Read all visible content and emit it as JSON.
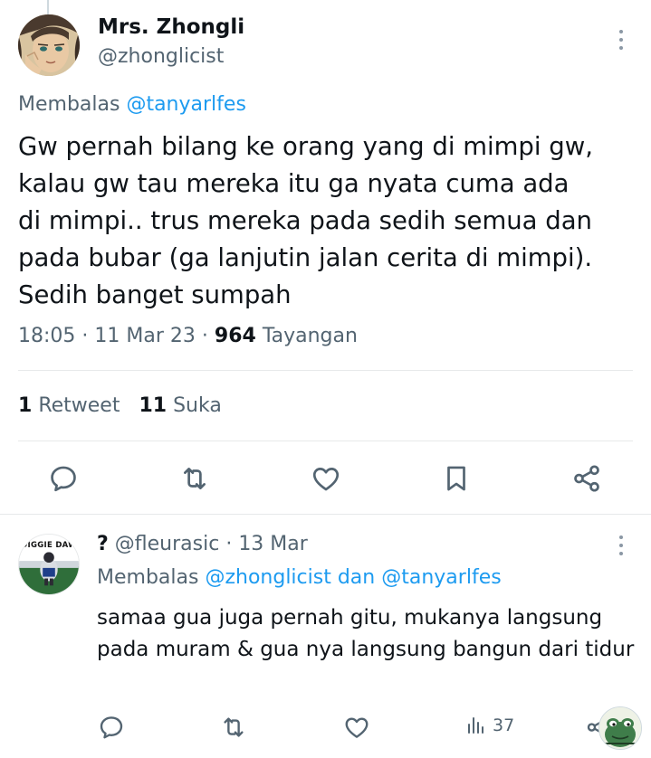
{
  "main_tweet": {
    "display_name": "Mrs. Zhongli",
    "handle": "@zhonglicist",
    "replying_prefix": "Membalas",
    "replying_to": "@tanyarlfes",
    "text": "Gw pernah bilang ke orang yang di mimpi gw,\nkalau gw tau mereka itu ga nyata cuma ada\ndi mimpi.. trus mereka pada sedih semua dan\npada bubar (ga lanjutin jalan cerita di mimpi).\nSedih banget sumpah",
    "time": "18:05",
    "date": "11 Mar 23",
    "views_count": "964",
    "views_label": "Tayangan",
    "retweet_count": "1",
    "retweet_label": "Retweet",
    "like_count": "11",
    "like_label": "Suka",
    "sep": "·"
  },
  "reply": {
    "display_name": "?",
    "handle": "@fleurasic",
    "date": "13 Mar",
    "replying_prefix": "Membalas",
    "replying_to_1": "@zhonglicist",
    "replying_conj": "dan",
    "replying_to_2": "@tanyarlfes",
    "text": "samaa gua juga pernah gitu, mukanya langsung pada muram & gua nya langsung bangun dari tidur",
    "views_count": "37",
    "avatar_caption": "DIGGIE DAW"
  },
  "icons": {
    "reply": "reply-icon",
    "retweet": "retweet-icon",
    "like": "heart-icon",
    "bookmark": "bookmark-icon",
    "share": "share-icon",
    "views": "views-bar-icon",
    "more": "more-vertical-icon"
  },
  "colors": {
    "text": "#0f1419",
    "secondary": "#536471",
    "accent": "#1d9bf0",
    "divider": "#e7e9ea",
    "icon": "#536471"
  }
}
